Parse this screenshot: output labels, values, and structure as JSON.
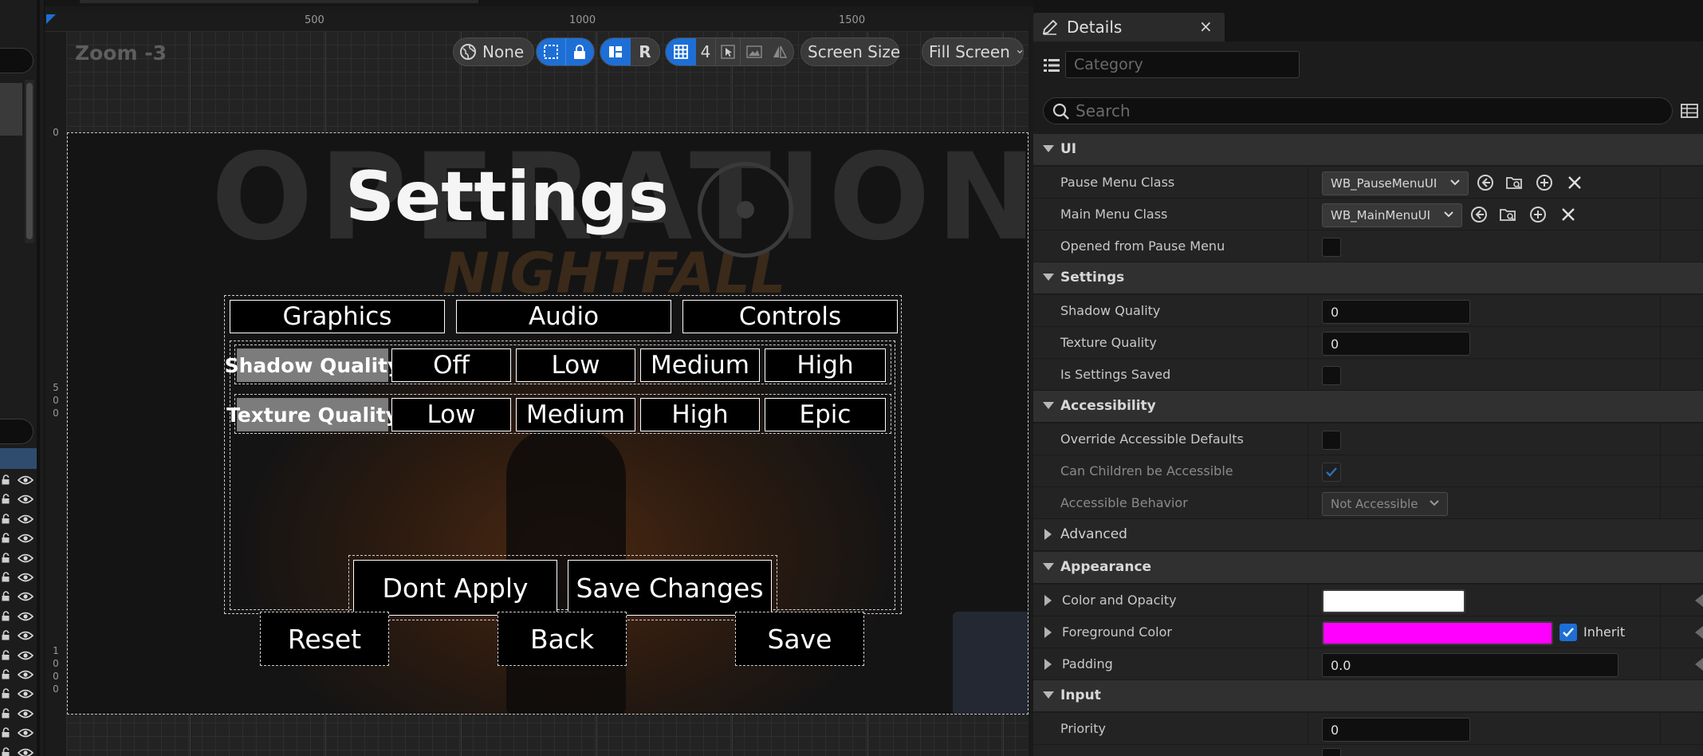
{
  "canvas": {
    "zoom_label": "Zoom -3",
    "ruler_top": [
      "500",
      "1000",
      "1500"
    ],
    "ruler_left": [
      {
        "digits": [
          "0"
        ]
      },
      {
        "digits": [
          "5",
          "0",
          "0"
        ]
      },
      {
        "digits": [
          "1",
          "0",
          "0",
          "0"
        ]
      }
    ],
    "toolbar": {
      "world_label": "None",
      "r_label": "R",
      "grid_value": "4",
      "screen_size_label": "Screen Size",
      "fill_screen_label": "Fill Screen"
    }
  },
  "widget": {
    "title": "Settings",
    "tabs": [
      "Graphics",
      "Audio",
      "Controls"
    ],
    "shadow_quality": {
      "label": "Shadow Quality",
      "options": [
        "Off",
        "Low",
        "Medium",
        "High"
      ]
    },
    "texture_quality": {
      "label": "Texture Quality",
      "options": [
        "Low",
        "Medium",
        "High",
        "Epic"
      ]
    },
    "dont_apply": "Dont Apply",
    "save_changes": "Save Changes",
    "reset": "Reset",
    "back": "Back",
    "save": "Save"
  },
  "details": {
    "tab_title": "Details",
    "close_glyph": "×",
    "category_placeholder": "Category",
    "search_placeholder": "Search",
    "sections": {
      "ui": "UI",
      "settings": "Settings",
      "accessibility": "Accessibility",
      "advanced": "Advanced",
      "appearance": "Appearance",
      "input": "Input"
    },
    "props": {
      "pause_menu_class": {
        "name": "Pause Menu Class",
        "value": "WB_PauseMenuUI"
      },
      "main_menu_class": {
        "name": "Main Menu Class",
        "value": "WB_MainMenuUI"
      },
      "opened_from_pause": {
        "name": "Opened from Pause Menu"
      },
      "shadow_quality": {
        "name": "Shadow Quality",
        "value": "0"
      },
      "texture_quality": {
        "name": "Texture Quality",
        "value": "0"
      },
      "is_settings_saved": {
        "name": "Is Settings Saved"
      },
      "override_accessible": {
        "name": "Override Accessible Defaults"
      },
      "can_children_accessible": {
        "name": "Can Children be Accessible"
      },
      "accessible_behavior": {
        "name": "Accessible Behavior",
        "value": "Not Accessible"
      },
      "color_and_opacity": {
        "name": "Color and Opacity",
        "color": "#ffffff"
      },
      "foreground_color": {
        "name": "Foreground Color",
        "color": "#ff00ff",
        "inherit_label": "Inherit"
      },
      "padding": {
        "name": "Padding",
        "value": "0.0"
      },
      "priority": {
        "name": "Priority",
        "value": "0"
      }
    }
  },
  "colors": {
    "accent": "#1d6fd6",
    "panel": "#232323",
    "section_header": "#303030"
  }
}
